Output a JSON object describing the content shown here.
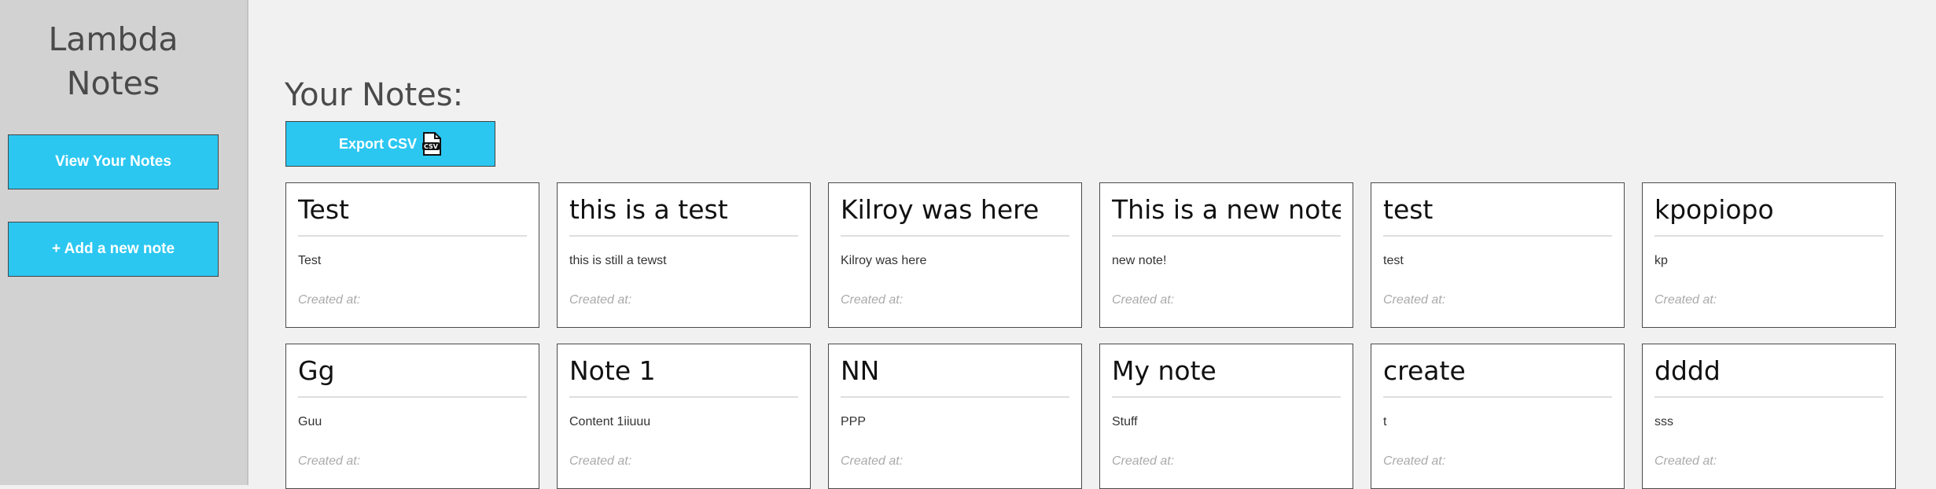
{
  "app": {
    "title_line1": "Lambda",
    "title_line2": "Notes"
  },
  "sidebar": {
    "view_notes_label": "View Your Notes",
    "add_note_label": "+ Add a new note"
  },
  "main": {
    "heading": "Your Notes:",
    "export_label": "Export CSV",
    "export_icon": "csv-file-icon"
  },
  "colors": {
    "accent": "#2bc7f1",
    "sidebar_bg": "#d3d2d3",
    "page_bg": "#f1f1f1"
  },
  "notes": [
    {
      "title": "Test",
      "content": "Test",
      "created": "Created at:"
    },
    {
      "title": "this is a test",
      "content": "this is still a tewst",
      "created": "Created at:"
    },
    {
      "title": "Kilroy was here",
      "content": "Kilroy was here",
      "created": "Created at:"
    },
    {
      "title": "This is a new note",
      "content": "new note!",
      "created": "Created at:"
    },
    {
      "title": "test",
      "content": "test",
      "created": "Created at:"
    },
    {
      "title": "kpopiopo",
      "content": "kp",
      "created": "Created at:"
    },
    {
      "title": "Gg",
      "content": "Guu",
      "created": "Created at:"
    },
    {
      "title": "Note 1",
      "content": "Content 1iiuuu",
      "created": "Created at:"
    },
    {
      "title": "NN",
      "content": "PPP",
      "created": "Created at:"
    },
    {
      "title": "My note",
      "content": "Stuff",
      "created": "Created at:"
    },
    {
      "title": "create",
      "content": "t",
      "created": "Created at:"
    },
    {
      "title": "dddd",
      "content": "sss",
      "created": "Created at:"
    }
  ]
}
